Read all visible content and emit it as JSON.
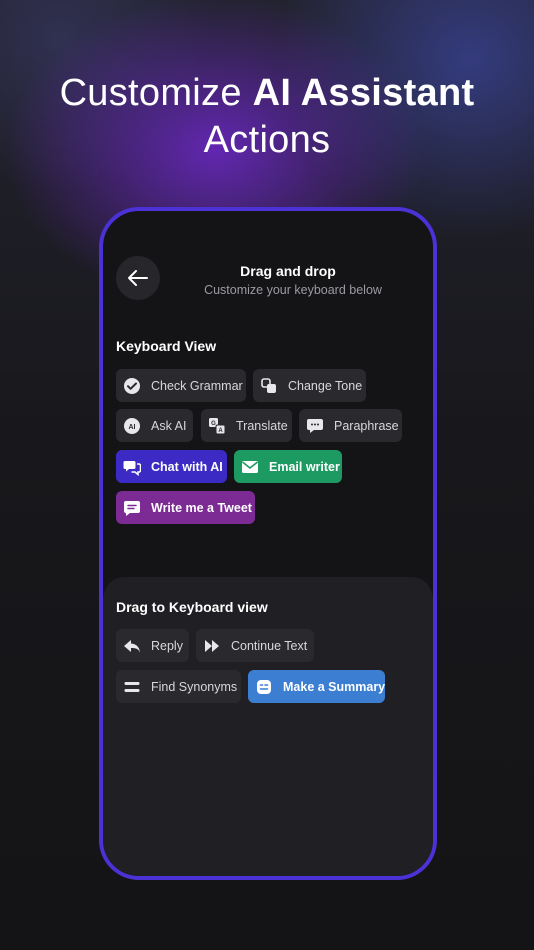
{
  "headline": {
    "light": "Customize ",
    "bold": "AI Assistant",
    "line2": "Actions"
  },
  "header": {
    "title": "Drag and drop",
    "subtitle": "Customize your keyboard below"
  },
  "keyboard_view": {
    "title": "Keyboard View",
    "chips": {
      "check_grammar": "Check Grammar",
      "change_tone": "Change Tone",
      "ask_ai": "Ask AI",
      "translate": "Translate",
      "paraphrase": "Paraphrase",
      "chat_with_ai": "Chat with AI",
      "email_writer": "Email writer",
      "write_tweet": "Write me a Tweet"
    }
  },
  "drag_area": {
    "title": "Drag to Keyboard view",
    "chips": {
      "reply": "Reply",
      "continue_text": "Continue Text",
      "find_synonyms": "Find Synonyms",
      "make_summary": "Make a Summary"
    }
  },
  "colors": {
    "phone_border": "#4b32d6",
    "chat_with_ai": "#3b2bc4",
    "email_writer": "#1d9a62",
    "write_tweet": "#7c2a94",
    "make_summary": "#3c7fd2"
  }
}
